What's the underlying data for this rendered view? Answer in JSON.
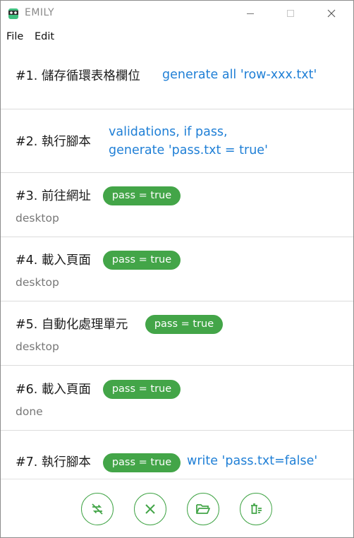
{
  "window": {
    "title": "EMILY",
    "controls": [
      "minimize",
      "maximize",
      "close"
    ]
  },
  "menu": {
    "file": "File",
    "edit": "Edit"
  },
  "steps": [
    {
      "title": "#1. 儲存循環表格欄位",
      "note": "generate all 'row-xxx.txt'"
    },
    {
      "title": "#2. 執行腳本",
      "note_line1": "validations, if pass,",
      "note_line2": "generate 'pass.txt = true'"
    },
    {
      "title": "#3. 前往網址",
      "badge": "pass = true",
      "subtitle": "desktop"
    },
    {
      "title": "#4. 載入頁面",
      "badge": "pass = true",
      "subtitle": "desktop"
    },
    {
      "title": "#5. 自動化處理單元",
      "badge": "pass = true",
      "subtitle": "desktop"
    },
    {
      "title": "#6. 載入頁面",
      "badge": "pass = true",
      "subtitle": "done"
    },
    {
      "title": "#7. 執行腳本",
      "badge": "pass = true",
      "note": "write 'pass.txt=false'"
    }
  ],
  "toolbar": {
    "buttons": [
      "repeat-off-icon",
      "close-icon",
      "folder-open-icon",
      "delete-list-icon"
    ]
  },
  "colors": {
    "accent_green": "#43a548",
    "note_blue": "#1f7fd6",
    "subtitle_gray": "#777777"
  }
}
